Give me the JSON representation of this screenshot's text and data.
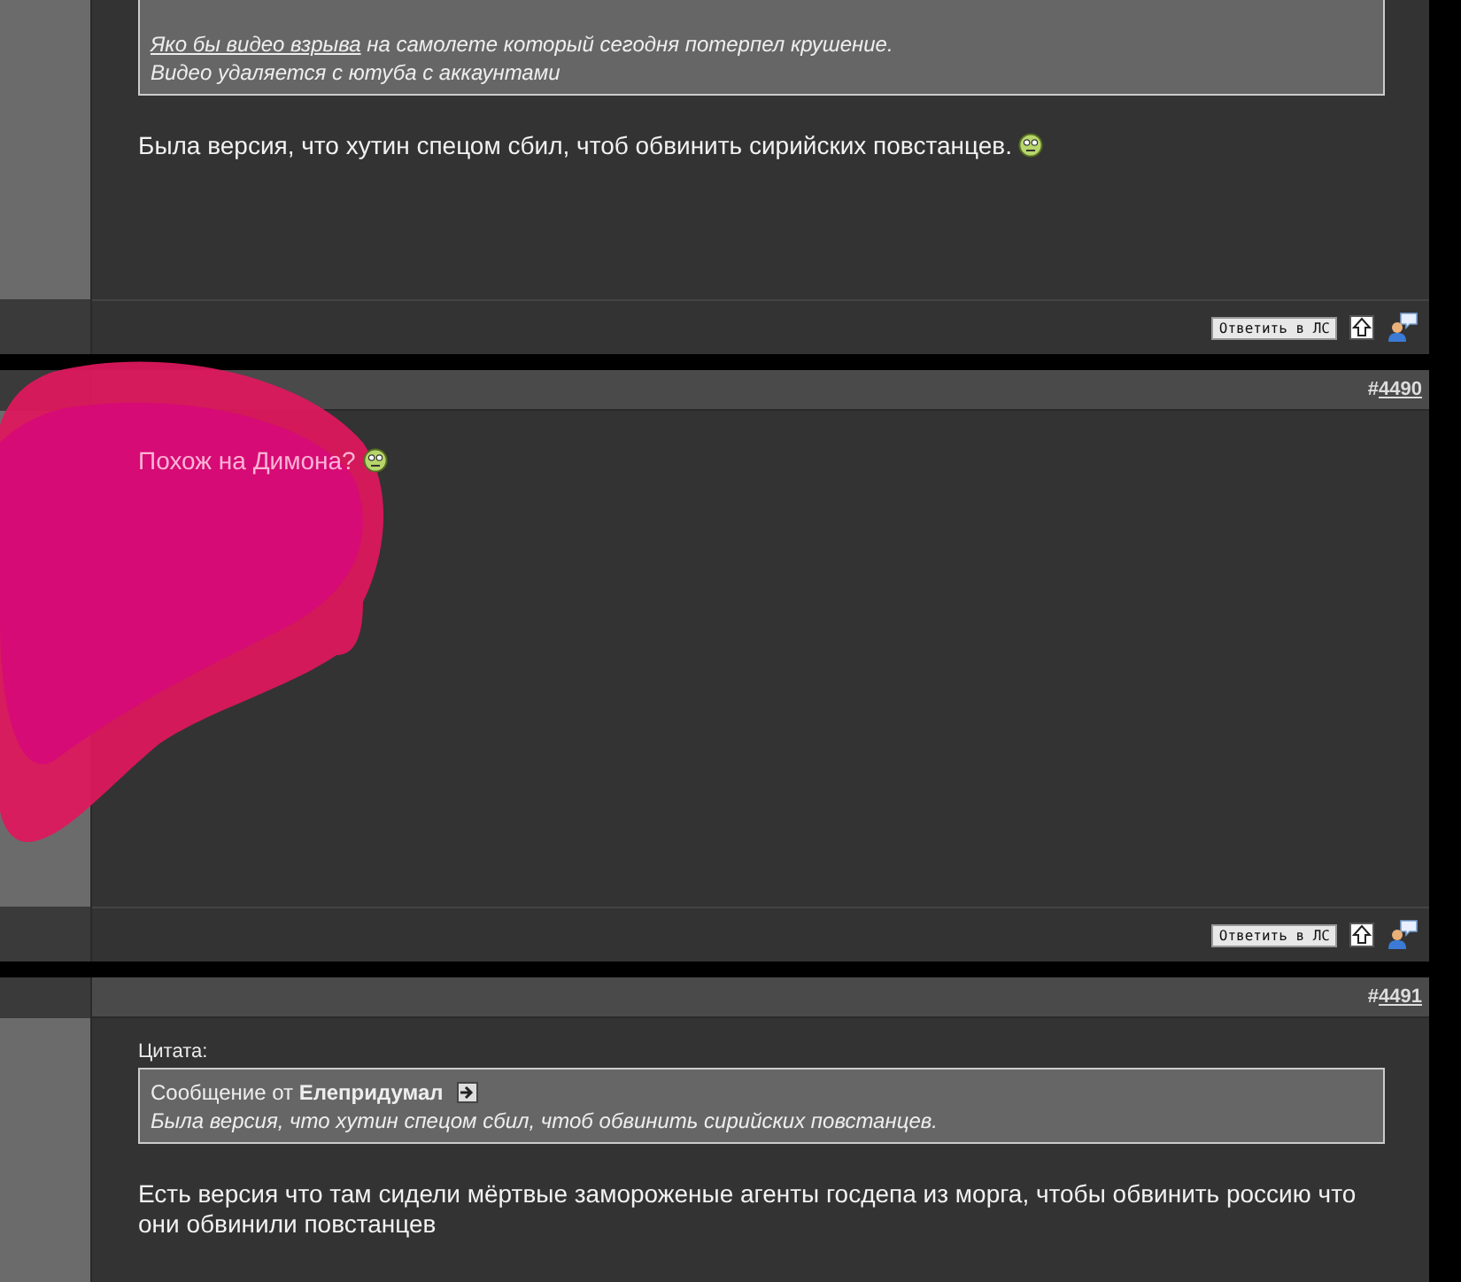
{
  "posts": [
    {
      "quote": {
        "lines": [
          {
            "link": "Яко бы видео взрыва",
            "text": " на самолете который сегодня потерпел крушение."
          },
          {
            "text": "Видео удаляется с ютуба с аккаунтами"
          }
        ]
      },
      "body": "Была версия, что хутин спецом сбил, чтоб обвинить сирийских повстанцев.",
      "smiley": true,
      "reply_button": "Ответить в ЛС"
    },
    {
      "header": {
        "hash": "#",
        "number": "4490"
      },
      "body": "Похож на Димона?",
      "smiley": true,
      "redacted": true,
      "reply_button": "Ответить в ЛС"
    },
    {
      "header": {
        "hash": "#",
        "number": "4491"
      },
      "quote": {
        "label": "Цитата:",
        "author_prefix": "Сообщение от ",
        "author": "Елепридумал",
        "lines": [
          {
            "text": "Была версия, что хутин спецом сбил, чтоб обвинить сирийских повстанцев."
          }
        ]
      },
      "body": "Есть версия что там сидели мёртвые замороженые агенты госдепа из морга, чтобы обвинить россию что они обвинили повстанцев"
    }
  ]
}
